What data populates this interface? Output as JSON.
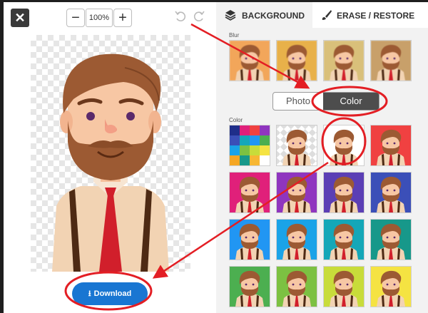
{
  "editor": {
    "close_icon": "close-icon",
    "zoom": {
      "minus": "−",
      "level": "100%",
      "plus": "+"
    },
    "undo_icon": "undo-icon",
    "redo_icon": "redo-icon",
    "download_label": "Download"
  },
  "panel": {
    "tabs": [
      {
        "label": "BACKGROUND",
        "icon": "layers-icon"
      },
      {
        "label": "ERASE / RESTORE",
        "icon": "brush-icon"
      }
    ],
    "blur_label": "Blur",
    "toggle": {
      "photo": "Photo",
      "color": "Color"
    },
    "color_label": "Color"
  },
  "colors": {
    "accent": "#1976d2",
    "annotation": "#e31e24",
    "swatches": [
      "#ffffff",
      "#f04141",
      "#e0207a",
      "#8f35bf",
      "#5b3fb5",
      "#3b4fb8",
      "#2196f3",
      "#1aa3e8",
      "#14a7b8",
      "#17988a",
      "#4caf50",
      "#7cc142",
      "#c8dc3a",
      "#f5e342"
    ]
  }
}
